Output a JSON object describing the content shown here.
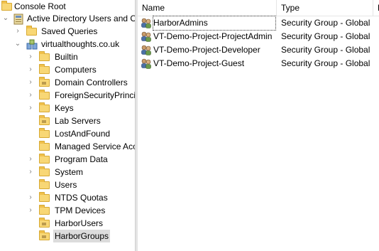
{
  "tree": {
    "root": "Console Root",
    "aduc": "Active Directory Users and C",
    "saved_queries": "Saved Queries",
    "domain": "virtualthoughts.co.uk",
    "children": [
      {
        "label": "Builtin",
        "expander": true,
        "icon": "folder-icon"
      },
      {
        "label": "Computers",
        "expander": true,
        "icon": "folder-icon"
      },
      {
        "label": "Domain Controllers",
        "expander": true,
        "icon": "ou-icon"
      },
      {
        "label": "ForeignSecurityPrinci",
        "expander": true,
        "icon": "folder-icon"
      },
      {
        "label": "Keys",
        "expander": true,
        "icon": "folder-icon"
      },
      {
        "label": "Lab Servers",
        "expander": false,
        "icon": "ou-icon"
      },
      {
        "label": "LostAndFound",
        "expander": false,
        "icon": "folder-icon"
      },
      {
        "label": "Managed Service Acc",
        "expander": false,
        "icon": "folder-icon"
      },
      {
        "label": "Program Data",
        "expander": true,
        "icon": "folder-icon"
      },
      {
        "label": "System",
        "expander": true,
        "icon": "folder-icon"
      },
      {
        "label": "Users",
        "expander": false,
        "icon": "folder-icon"
      },
      {
        "label": "NTDS Quotas",
        "expander": true,
        "icon": "folder-icon"
      },
      {
        "label": "TPM Devices",
        "expander": true,
        "icon": "folder-icon"
      },
      {
        "label": "HarborUsers",
        "expander": false,
        "icon": "ou-icon"
      },
      {
        "label": "HarborGroups",
        "expander": false,
        "icon": "ou-icon",
        "selected": true
      }
    ]
  },
  "list": {
    "columns": [
      "Name",
      "Type",
      "D"
    ],
    "rows": [
      {
        "name": "HarborAdmins",
        "type": "Security Group - Global"
      },
      {
        "name": "VT-Demo-Project-ProjectAdmin",
        "type": "Security Group - Global"
      },
      {
        "name": "VT-Demo-Project-Developer",
        "type": "Security Group - Global"
      },
      {
        "name": "VT-Demo-Project-Guest",
        "type": "Security Group - Global"
      }
    ]
  }
}
